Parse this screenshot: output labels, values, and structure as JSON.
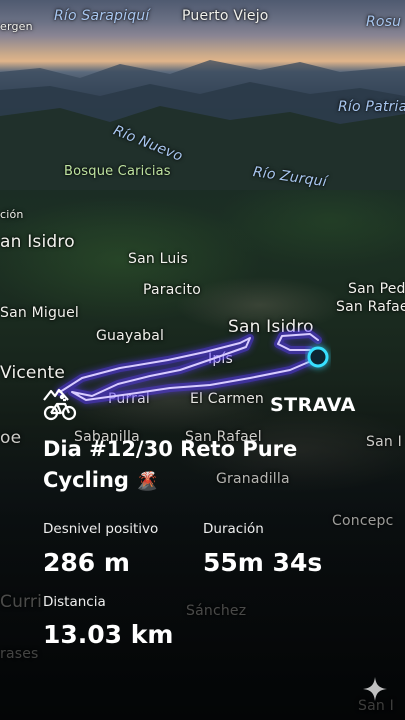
{
  "map": {
    "labels": {
      "rio_sarapiqui": "Río Sarapiquí",
      "puerto_viejo": "Puerto Viejo",
      "rosu": "Rosu",
      "ergen": "ergen",
      "rio_patria": "Río Patria",
      "rio_nuevo": "Río Nuevo",
      "bosque_caricias": "Bosque Caricias",
      "rio_zurqui": "Río Zurquí",
      "cion": "ción",
      "an_isidro": "an Isidro",
      "san_luis": "San Luis",
      "paracito": "Paracito",
      "san_pedro": "San Ped",
      "san_rafael_right": "San Rafae",
      "san_miguel": "San Miguel",
      "guayabal": "Guayabal",
      "san_isidro": "San Isidro",
      "ipis": "Ipís",
      "vicente": "Vicente",
      "purral": "Purral",
      "el_carmen": "El Carmen",
      "oe": "oe",
      "sabanilla": "Sabanilla",
      "san_rafael": "San Rafael",
      "san_right": "San I",
      "granadilla": "Granadilla",
      "concepcion": "Concepc",
      "curri": "Curri",
      "sanchez": "Sánchez",
      "rases": "rases",
      "san_bottom": "San I"
    }
  },
  "activity": {
    "brand": "STRAVA",
    "title": "Dia #12/30 Reto Pure Cycling",
    "title_emoji": "🌋",
    "stats": {
      "elevation_label": "Desnivel positivo",
      "elevation_value": "286 m",
      "duration_label": "Duración",
      "duration_value": "55m 34s",
      "distance_label": "Distancia",
      "distance_value": "13.03 km"
    }
  },
  "colors": {
    "route": "#7a5cff",
    "route_glow": "#5b3bff",
    "endpoint": "#38e0ff"
  },
  "icons": {
    "activity_type": "bike-icon",
    "corner": "sparkle-icon"
  }
}
